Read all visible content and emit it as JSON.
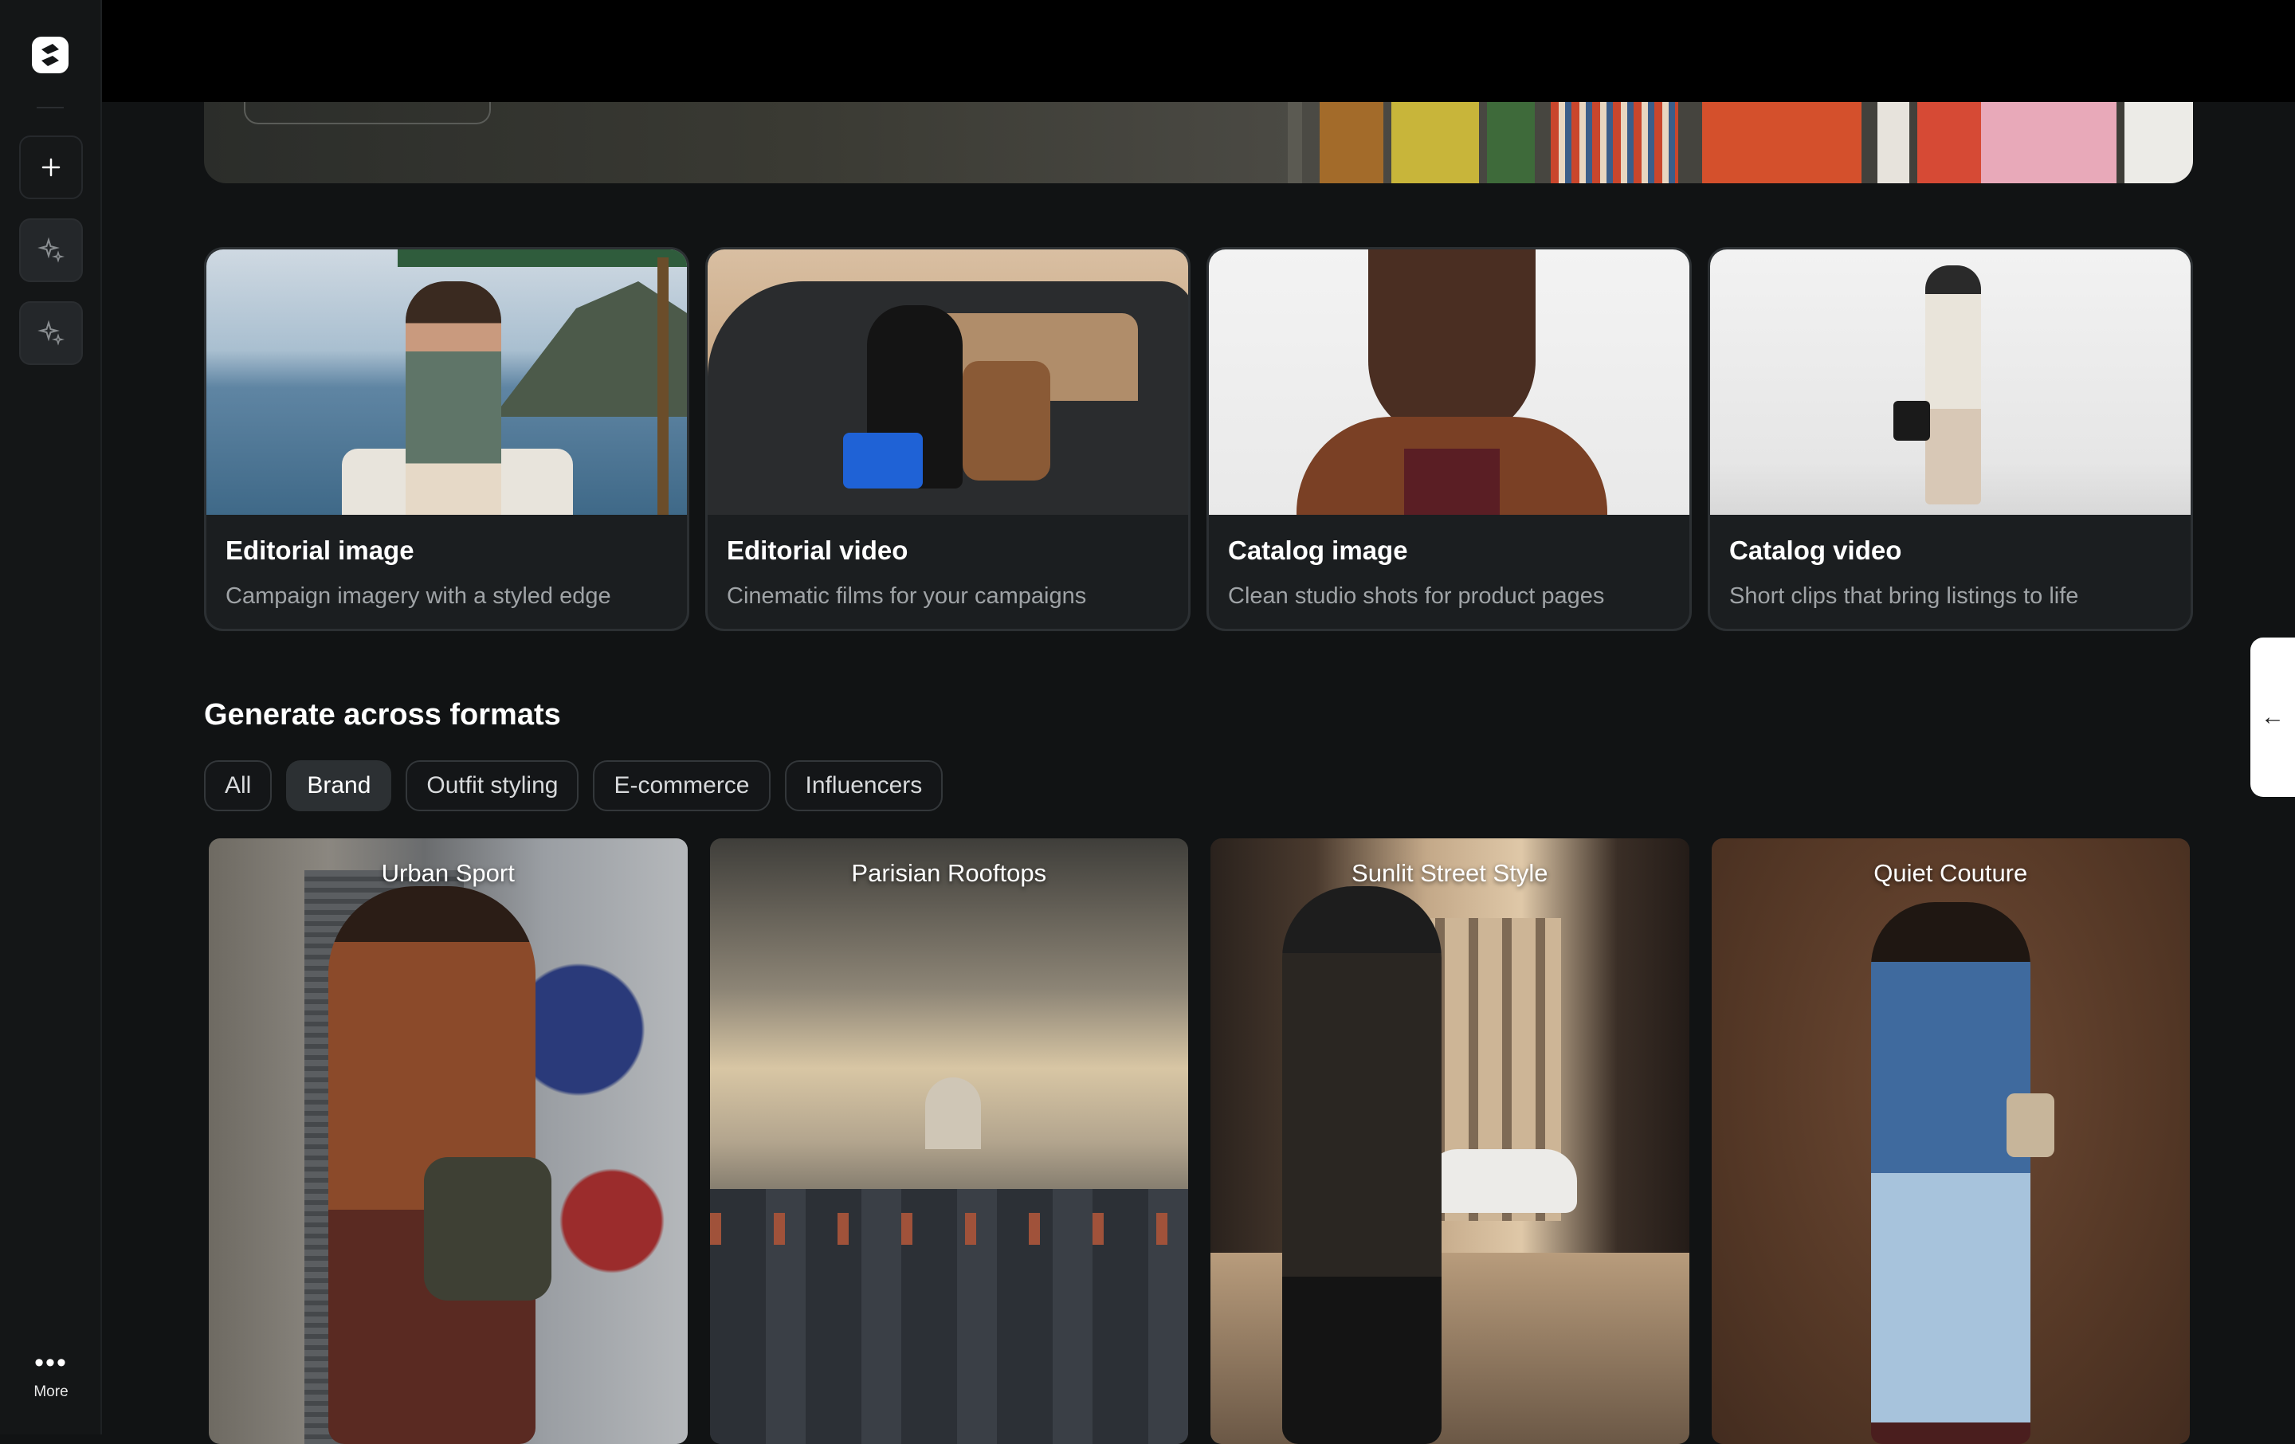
{
  "sidebar": {
    "logo_icon": "brand-logo-icon",
    "buttons": [
      {
        "icon": "plus-icon"
      },
      {
        "icon": "sparkle-icon"
      },
      {
        "icon": "sparkle-icon"
      }
    ],
    "more_label": "More"
  },
  "cards": [
    {
      "title": "Editorial image",
      "desc": "Campaign imagery with a styled edge"
    },
    {
      "title": "Editorial video",
      "desc": "Cinematic films for your campaigns"
    },
    {
      "title": "Catalog image",
      "desc": "Clean studio shots for product pages"
    },
    {
      "title": "Catalog video",
      "desc": "Short clips that bring listings to life"
    }
  ],
  "section": {
    "title": "Generate across formats",
    "chips": [
      "All",
      "Brand",
      "Outfit styling",
      "E-commerce",
      "Influencers"
    ],
    "active_chip": "Brand"
  },
  "tiles": [
    {
      "label": "Urban Sport"
    },
    {
      "label": "Parisian Rooftops"
    },
    {
      "label": "Sunlit Street Style"
    },
    {
      "label": "Quiet Couture"
    }
  ],
  "side_tab": {
    "icon": "arrow-left-icon",
    "glyph": "←"
  }
}
